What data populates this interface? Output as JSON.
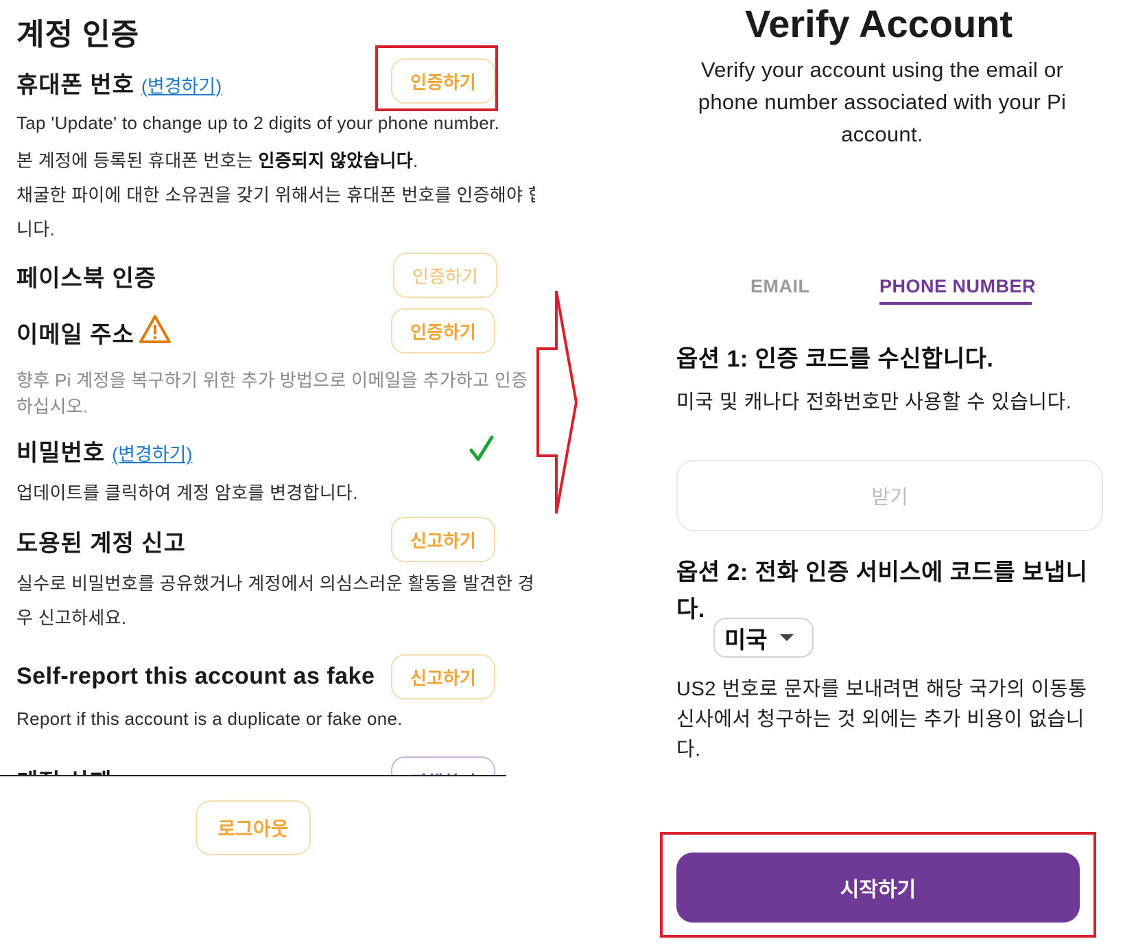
{
  "left": {
    "title": "계정 인증",
    "phone": {
      "heading": "휴대폰 번호",
      "change_link": "(변경하기)",
      "button": "인증하기",
      "note_en": "Tap 'Update' to change up to 2 digits of your phone number.",
      "status_prefix": "본 계정에 등록된 휴대폰 번호는 ",
      "status_bold": "인증되지 않았습니다",
      "status_suffix": ".",
      "ownership_line1": "채굴한 파이에 대한 소유권을 갖기 위해서는 휴대폰 번호를 인증해야 합",
      "ownership_line2": "니다."
    },
    "facebook": {
      "heading": "페이스북 인증",
      "button": "인증하기"
    },
    "email": {
      "heading": "이메일 주소",
      "button": "인증하기",
      "desc_line1": "향후 Pi 계정을 복구하기 위한 추가 방법으로 이메일을 추가하고 인증",
      "desc_line2": "하십시오.",
      "warning_icon": "warning-triangle-icon",
      "warning_color": "#e07b10"
    },
    "password": {
      "heading": "비밀번호",
      "change_link": "(변경하기)",
      "desc": "업데이트를 클릭하여 계정 암호를 변경합니다.",
      "check_icon": "checkmark-icon",
      "check_color": "#1ea33a"
    },
    "stolen": {
      "heading": "도용된 계정 신고",
      "button": "신고하기",
      "desc_line1": "실수로 비밀번호를 공유했거나 계정에서 의심스러운 활동을 발견한 경",
      "desc_line2": "우 신고하세요."
    },
    "fake": {
      "heading": "Self-report this account as fake",
      "button": "신고하기",
      "desc": "Report if this account is a duplicate or fake one."
    },
    "delete": {
      "heading": "계정 삭제",
      "button": "진행하기"
    },
    "logout_button": "로그아웃"
  },
  "right": {
    "title": "Verify Account",
    "description": "Verify your account using the email or phone number associated with your Pi account.",
    "tabs": [
      {
        "label": "EMAIL",
        "active": false
      },
      {
        "label": "PHONE NUMBER",
        "active": true
      }
    ],
    "option1": {
      "heading": "옵션 1: 인증 코드를 수신합니다.",
      "note": "미국 및 캐나다 전화번호만 사용할 수 있습니다.",
      "button": "받기"
    },
    "option2": {
      "heading_line1": "옵션 2: 전화 인증 서비스에 코드를 보냅니",
      "heading_line2": "다.",
      "country": "미국",
      "note_line1": "US2 번호로 문자를 보내려면 해당 국가의 이동통",
      "note_line2": "신사에서 청구하는 것 외에는 추가 비용이 없습니",
      "note_line3": "다."
    },
    "start_button": "시작하기"
  },
  "colors": {
    "accent_orange": "#efa434",
    "accent_purple": "#6f3a95",
    "highlight_red": "#d7222d",
    "link_blue": "#1e79c8"
  },
  "arrow_icon": "right-arrow-icon"
}
